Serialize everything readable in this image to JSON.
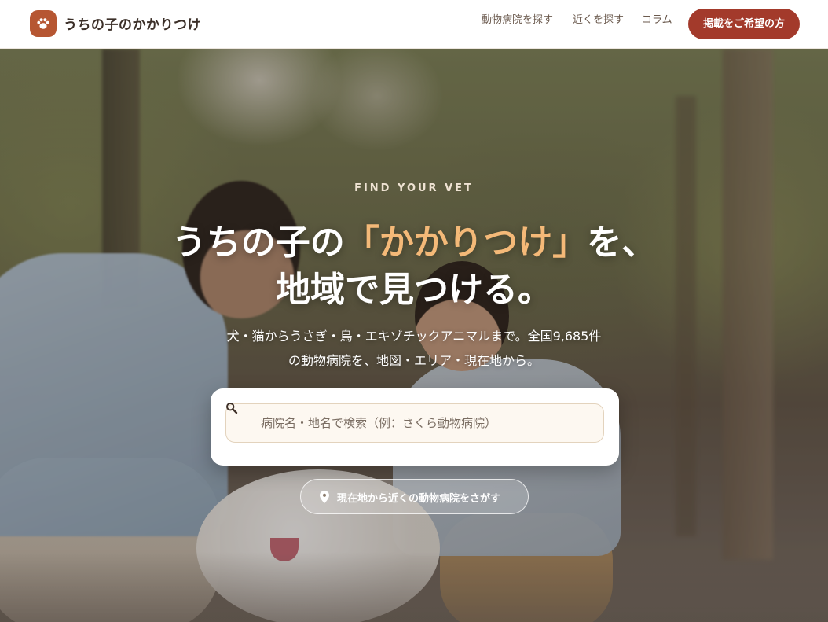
{
  "header": {
    "logo_text": "うちの子のかかりつけ",
    "nav": [
      "動物病院を探す",
      "近くを探す",
      "コラム"
    ],
    "cta_label": "掲載をご希望の方"
  },
  "hero": {
    "eyebrow": "FIND YOUR VET",
    "headline": {
      "line1_before": "うちの子の",
      "line1_accent": "「かかりつけ」",
      "line1_after": "を、",
      "line2": "地域で見つける。"
    },
    "subtitle": {
      "line1": "犬・猫からうさぎ・鳥・エキゾチックアニマルまで。全国9,685件",
      "line2": "の動物病院を、地図・エリア・現在地から。"
    },
    "search": {
      "placeholder": "病院名・地名で検索（例：さくら動物病院）",
      "value": ""
    },
    "locate_label": "現在地から近くの動物病院をさがす"
  },
  "colors": {
    "brand": "#b65632",
    "cta": "#a33a2b",
    "accent_text": "#f4b978"
  },
  "icons": {
    "logo": "paw-icon",
    "search": "search-icon",
    "locate": "location-pin-icon"
  }
}
